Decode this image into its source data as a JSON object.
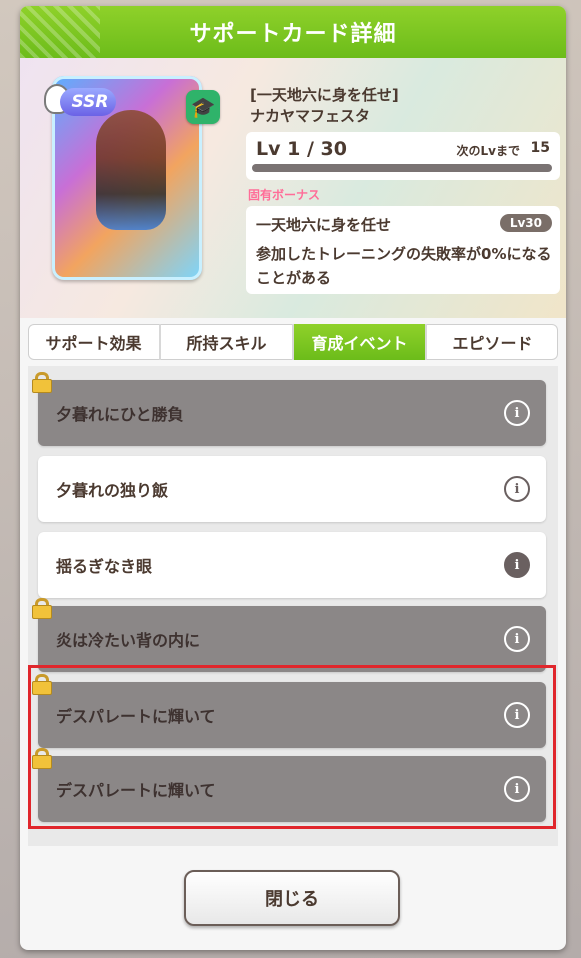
{
  "dialog": {
    "title": "サポートカード詳細",
    "close_label": "閉じる"
  },
  "card": {
    "rarity": "SSR",
    "type_icon": "cap-icon",
    "title_line1": "[一天地六に身を任せ]",
    "title_line2": "ナカヤマフェスタ",
    "level_text": "Lv 1 / 30",
    "next_lv_label": "次のLvまで",
    "next_lv_value": "15",
    "level_progress": 0.0
  },
  "bonus": {
    "section_label": "固有ボーナス",
    "name": "一天地六に身を任せ",
    "level_badge": "Lv30",
    "description": "参加したトレーニングの失敗率が0%になることがある"
  },
  "tabs": [
    {
      "label": "サポート効果",
      "active": false
    },
    {
      "label": "所持スキル",
      "active": false
    },
    {
      "label": "育成イベント",
      "active": true
    },
    {
      "label": "エピソード",
      "active": false
    }
  ],
  "events": [
    {
      "label": "夕暮れにひと勝負",
      "locked": true
    },
    {
      "label": "夕暮れの独り飯",
      "locked": false
    },
    {
      "label": "揺るぎなき眼",
      "locked": false
    },
    {
      "label": "炎は冷たい背の内に",
      "locked": true
    },
    {
      "label": "デスパレートに輝いて",
      "locked": true
    },
    {
      "label": "デスパレートに輝いて",
      "locked": true
    }
  ],
  "colors": {
    "accent_green": "#7cc61f",
    "highlight_red": "#e0262c",
    "bonus_pink": "#ff6d98"
  }
}
